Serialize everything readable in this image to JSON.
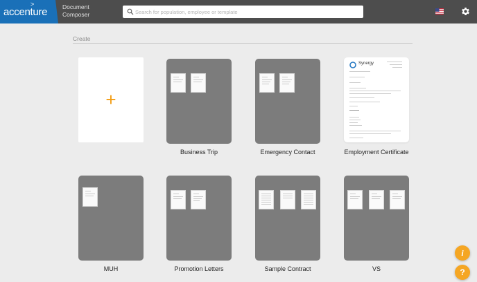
{
  "header": {
    "logo_text": "accenture",
    "app_name_line1": "Document",
    "app_name_line2": "Composer",
    "search_placeholder": "Search for population, employee or template",
    "flag_icon": "us-flag-icon",
    "settings_icon": "gear-icon"
  },
  "section": {
    "title": "Create"
  },
  "templates": [
    {
      "label": "Business Trip"
    },
    {
      "label": "Emergency Contact"
    },
    {
      "label": "Employment Certificate"
    },
    {
      "label": "MUH"
    },
    {
      "label": "Promotion Letters"
    },
    {
      "label": "Sample Contract"
    },
    {
      "label": "VS"
    }
  ],
  "document_preview": {
    "brand": "Synergy"
  },
  "fabs": {
    "info_label": "i",
    "help_label": "?"
  },
  "colors": {
    "accent": "#f5a623",
    "brand": "#1a70b8",
    "topbar": "#4d4d4d",
    "tile": "#7c7c7c"
  }
}
